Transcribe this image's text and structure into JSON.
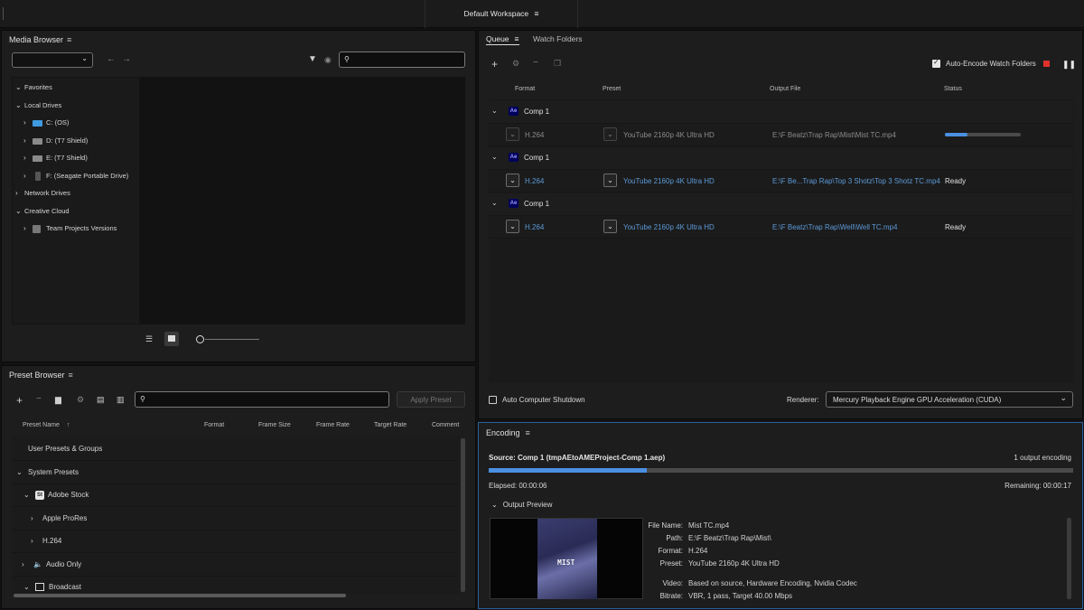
{
  "workspace": {
    "label": "Default Workspace",
    "menu": "≡"
  },
  "media_browser": {
    "title": "Media Browser",
    "menu": "≡",
    "tree": [
      {
        "label": "Favorites",
        "icon": ""
      },
      {
        "label": "Local Drives",
        "icon": ""
      },
      {
        "label": "C: (OS)",
        "icon": "windows-drive-icon"
      },
      {
        "label": "D: (T7 Shield)",
        "icon": "drive-icon"
      },
      {
        "label": "E: (T7 Shield)",
        "icon": "drive-icon"
      },
      {
        "label": "F: (Seagate Portable Drive)",
        "icon": "external-drive-icon"
      },
      {
        "label": "Network Drives",
        "icon": ""
      },
      {
        "label": "Creative Cloud",
        "icon": ""
      },
      {
        "label": "Team Projects Versions",
        "icon": "team-projects-icon"
      }
    ]
  },
  "preset_browser": {
    "title": "Preset Browser",
    "menu": "≡",
    "apply_label": "Apply Preset",
    "columns": [
      "Preset Name",
      "Format",
      "Frame Size",
      "Frame Rate",
      "Target Rate",
      "Comment"
    ],
    "rows": [
      {
        "label": "User Presets & Groups"
      },
      {
        "label": "System Presets"
      },
      {
        "label": "Adobe Stock",
        "badge": "St"
      },
      {
        "label": "Apple ProRes"
      },
      {
        "label": "H.264"
      },
      {
        "label": "Audio Only"
      },
      {
        "label": "Broadcast"
      }
    ]
  },
  "queue": {
    "tabs": [
      "Queue",
      "Watch Folders"
    ],
    "menu": "≡",
    "auto_encode_label": "Auto-Encode Watch Folders",
    "columns": [
      "Format",
      "Preset",
      "Output File",
      "Status"
    ],
    "groups": [
      {
        "name": "Comp 1",
        "format": "H.264",
        "preset": "YouTube 2160p 4K Ultra HD",
        "output": "E:\\F Beatz\\Trap Rap\\Mist\\Mist TC.mp4",
        "status": "",
        "progress": 0.3
      },
      {
        "name": "Comp 1",
        "format": "H.264",
        "preset": "YouTube 2160p 4K Ultra HD",
        "output": "E:\\F Be...Trap Rap\\Top 3 Shotz\\Top 3 Shotz TC.mp4",
        "status": "Ready"
      },
      {
        "name": "Comp 1",
        "format": "H.264",
        "preset": "YouTube 2160p 4K Ultra HD",
        "output": "E:\\F Beatz\\Trap Rap\\Well\\Well TC.mp4",
        "status": "Ready"
      }
    ],
    "auto_shutdown_label": "Auto Computer Shutdown",
    "renderer_label": "Renderer:",
    "renderer_value": "Mercury Playback Engine GPU Acceleration (CUDA)"
  },
  "encoding": {
    "title": "Encoding",
    "menu": "≡",
    "source": "Source: Comp 1 (tmpAEtoAMEProject-Comp 1.aep)",
    "outputs": "1 output encoding",
    "progress": 0.27,
    "elapsed": "Elapsed: 00:00:06",
    "remaining": "Remaining: 00:00:17",
    "output_preview_label": "Output Preview",
    "thumb_title": "MIST",
    "details": {
      "file_name_label": "File Name:",
      "file_name": "Mist TC.mp4",
      "path_label": "Path:",
      "path": "E:\\F Beatz\\Trap Rap\\Mist\\",
      "format_label": "Format:",
      "format": "H.264",
      "preset_label": "Preset:",
      "preset": "YouTube 2160p 4K Ultra HD",
      "video_label": "Video:",
      "video": "Based on source, Hardware Encoding, Nvidia Codec",
      "bitrate_label": "Bitrate:",
      "bitrate": "VBR, 1 pass, Target 40.00 Mbps"
    }
  },
  "colors": {
    "accent": "#4a90e2",
    "link": "#5d9ad8",
    "stop": "#e0322b",
    "ae_badge": "#00005b"
  }
}
